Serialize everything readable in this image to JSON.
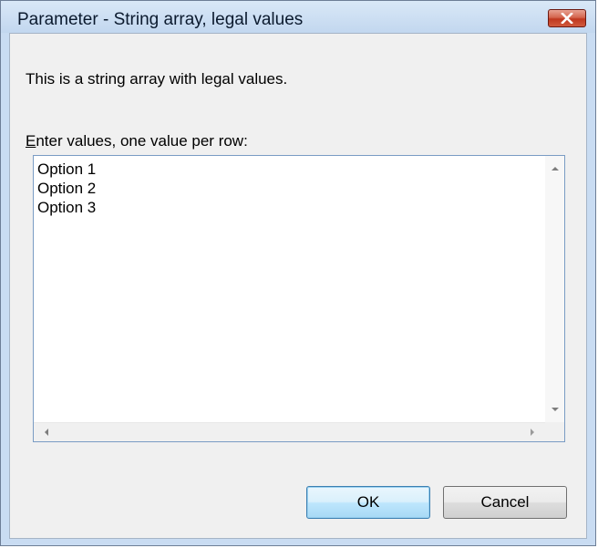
{
  "window": {
    "title": "Parameter - String array, legal values",
    "close_icon": "close-icon"
  },
  "dialog": {
    "description": "This is a string array with legal values.",
    "field_label_mnemonic": "E",
    "field_label_rest": "nter values, one value per row:",
    "values": [
      "Option 1",
      "Option 2",
      "Option 3"
    ]
  },
  "buttons": {
    "ok_label": "OK",
    "cancel_label": "Cancel"
  },
  "colors": {
    "titlebar": "#c9dcf2",
    "close_button": "#c0381f",
    "default_button_border": "#3c7fb1",
    "listbox_border": "#7a9cc4"
  }
}
